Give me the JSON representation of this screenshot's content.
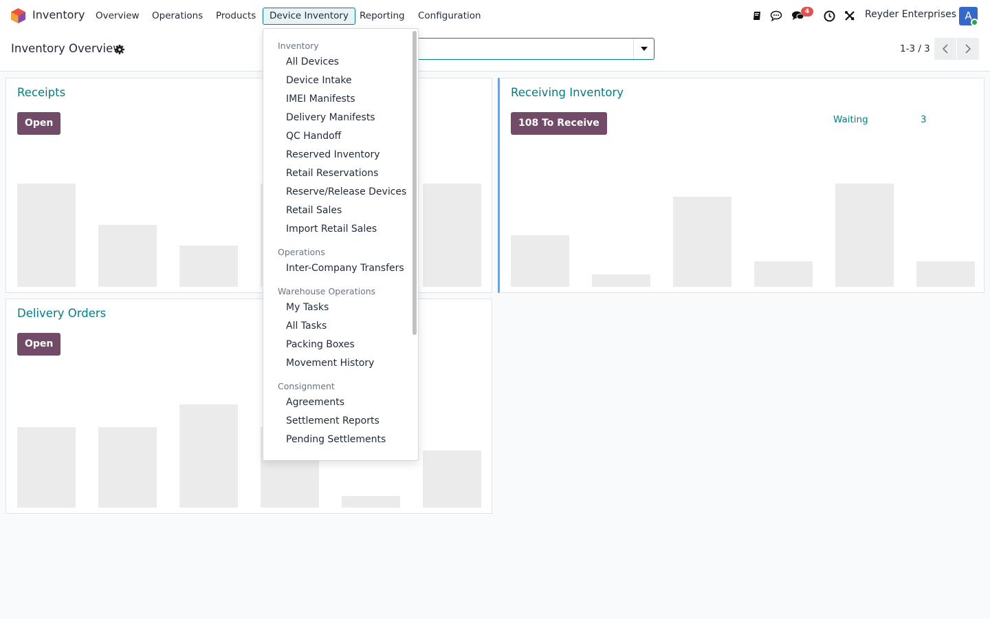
{
  "navbar": {
    "app_name": "Inventory",
    "menu": [
      "Overview",
      "Operations",
      "Products",
      "Device Inventory",
      "Reporting",
      "Configuration"
    ],
    "active_menu": "Device Inventory",
    "messages_count": "4",
    "company": "Reyder Enterprises",
    "avatar_letter": "A"
  },
  "control_panel": {
    "title": "Inventory Overview",
    "search_placeholder": "",
    "pager": "1-3 / 3"
  },
  "cards": {
    "receipts": {
      "title": "Receipts",
      "button": "Open",
      "bars": [
        150,
        90,
        60,
        150,
        150,
        150
      ]
    },
    "receiving": {
      "title": "Receiving Inventory",
      "button": "108 To Receive",
      "stat_label": "Waiting",
      "stat_value": "3",
      "bars": [
        75,
        18,
        131,
        37,
        150,
        37
      ]
    },
    "delivery": {
      "title": "Delivery Orders",
      "button": "Open",
      "bars": [
        117,
        117,
        150,
        117,
        17,
        83
      ]
    }
  },
  "dropdown": {
    "sections": [
      {
        "header": "Inventory",
        "items": [
          "All Devices",
          "Device Intake",
          "IMEI Manifests",
          "Delivery Manifests",
          "QC Handoff",
          "Reserved Inventory",
          "Retail Reservations",
          "Reserve/Release Devices",
          "Retail Sales",
          "Import Retail Sales"
        ]
      },
      {
        "header": "Operations",
        "items": [
          "Inter-Company Transfers"
        ]
      },
      {
        "header": "Warehouse Operations",
        "items": [
          "My Tasks",
          "All Tasks",
          "Packing Boxes",
          "Movement History"
        ]
      },
      {
        "header": "Consignment",
        "items": [
          "Agreements",
          "Settlement Reports",
          "Pending Settlements"
        ]
      }
    ]
  }
}
